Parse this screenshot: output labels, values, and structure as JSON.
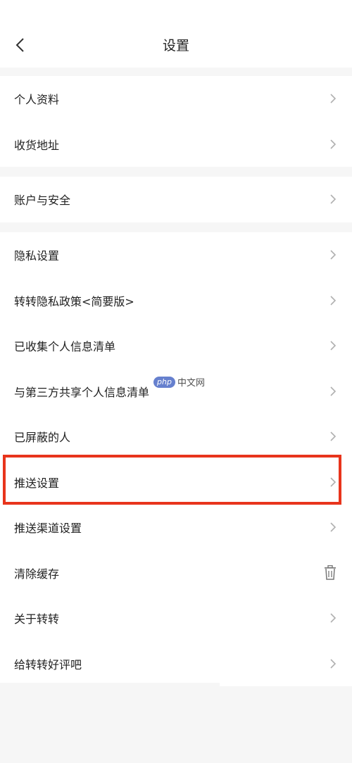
{
  "header": {
    "title": "设置",
    "back_icon": "chevron-left-icon"
  },
  "groups": [
    {
      "items": [
        {
          "label": "个人资料",
          "icon": "chevron-right-icon"
        },
        {
          "label": "收货地址",
          "icon": "chevron-right-icon"
        }
      ]
    },
    {
      "items": [
        {
          "label": "账户与安全",
          "icon": "chevron-right-icon"
        }
      ]
    },
    {
      "items": [
        {
          "label": "隐私设置",
          "icon": "chevron-right-icon"
        },
        {
          "label": "转转隐私政策<简要版>",
          "icon": "chevron-right-icon"
        },
        {
          "label": "已收集个人信息清单",
          "icon": "chevron-right-icon"
        },
        {
          "label": "与第三方共享个人信息清单",
          "icon": "chevron-right-icon"
        },
        {
          "label": "已屏蔽的人",
          "icon": "chevron-right-icon"
        },
        {
          "label": "推送设置",
          "icon": "chevron-right-icon",
          "highlighted": true
        },
        {
          "label": "推送渠道设置",
          "icon": "chevron-right-icon"
        },
        {
          "label": "清除缓存",
          "icon": "trash-icon"
        },
        {
          "label": "关于转转",
          "icon": "chevron-right-icon"
        },
        {
          "label": "给转转好评吧",
          "icon": "chevron-right-icon"
        }
      ]
    }
  ],
  "watermark": {
    "badge": "php",
    "text": "中文网"
  },
  "colors": {
    "highlight": "#e8341c",
    "background": "#f6f6f6",
    "chevron": "#b0b0b0"
  }
}
